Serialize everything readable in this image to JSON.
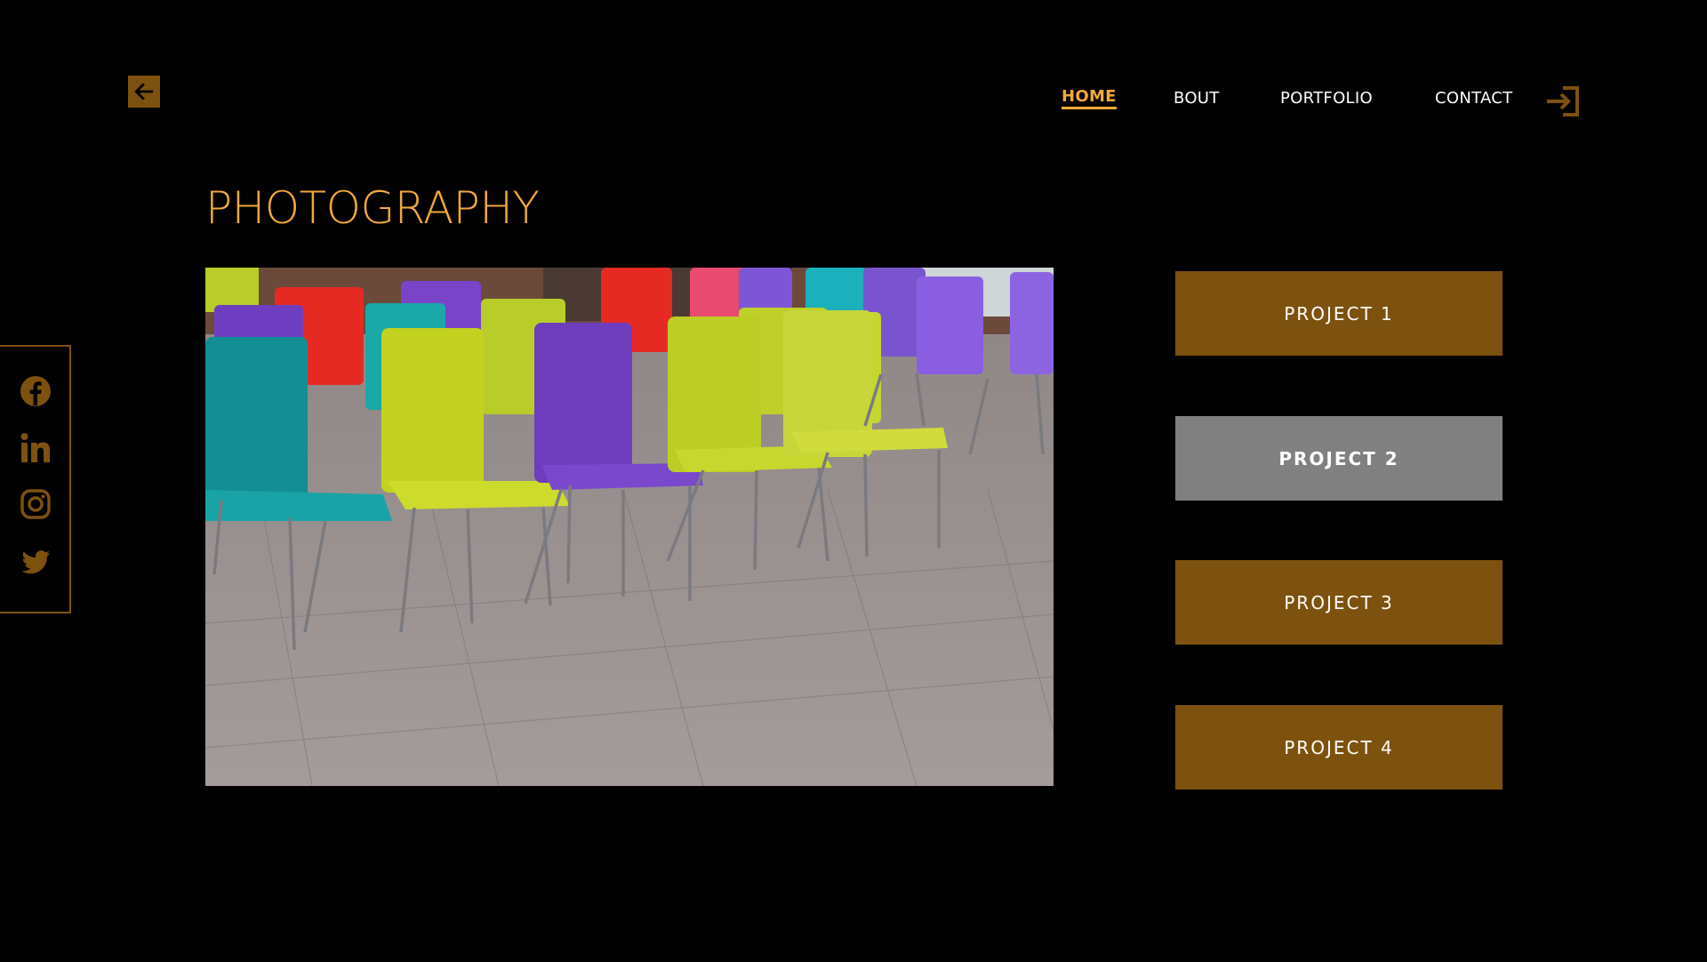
{
  "nav": {
    "items": [
      {
        "label": "HOME",
        "active": true
      },
      {
        "label": "BOUT",
        "active": false
      },
      {
        "label": "PORTFOLIO",
        "active": false
      },
      {
        "label": "CONTACT",
        "active": false
      }
    ]
  },
  "icons": {
    "back": "arrow-left-icon",
    "login": "sign-in-icon",
    "social": [
      "facebook-icon",
      "linkedin-icon",
      "instagram-icon",
      "twitter-icon"
    ]
  },
  "page": {
    "title": "PHOTOGRAPHY"
  },
  "projects": [
    {
      "label": "PROJECT 1",
      "selected": false
    },
    {
      "label": "PROJECT 2",
      "selected": true
    },
    {
      "label": "PROJECT 3",
      "selected": false
    },
    {
      "label": "PROJECT 4",
      "selected": false
    }
  ],
  "colors": {
    "background": "#000000",
    "accent": "#f2a93b",
    "accent_dark": "#7d520e",
    "selected": "#808080",
    "text": "#ffffff"
  }
}
